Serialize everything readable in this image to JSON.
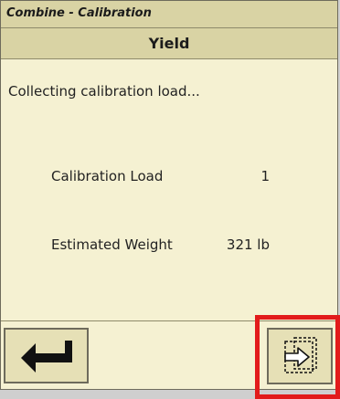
{
  "header": {
    "app_title": "Combine - Calibration",
    "section_title": "Yield"
  },
  "main": {
    "status_text": "Collecting calibration load...",
    "rows": [
      {
        "label": "Calibration Load",
        "value": "1"
      },
      {
        "label": "Estimated Weight",
        "value": "321 lb"
      }
    ]
  },
  "buttons": {
    "back_icon": "return-arrow-icon",
    "next_icon": "next-page-arrow-icon"
  },
  "colors": {
    "panel": "#f5f1d2",
    "header": "#d9d3a4",
    "button": "#e6e0b6",
    "highlight": "#e21b1b"
  }
}
